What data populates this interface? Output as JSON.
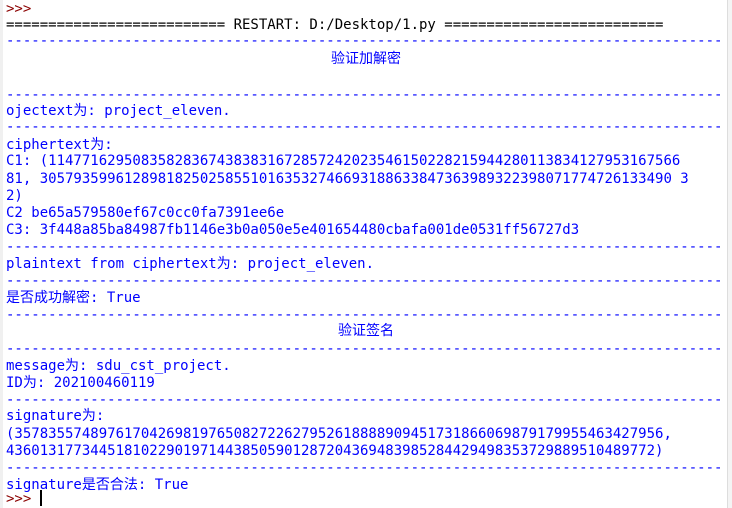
{
  "prompt_top": ">>>",
  "restart_line": "========================== RESTART: D:/Desktop/1.py ==========================",
  "sep": "-------------------------------------------------------------------------------------",
  "title_enc": "验证加解密",
  "plaintext_line": "ojectext为: project_eleven.",
  "cipher_label": "ciphertext为:",
  "c1_line1": "C1: (114771629508358283674383831672857242023546150228215944280113834127953167566",
  "c1_line2": "81, 305793599612898182502585510163532746693188633847363989322398071774726133490 3",
  "c1_line3": "2)",
  "c2_line": "C2 be65a579580ef67c0cc0fa7391ee6e",
  "c3_line": "C3: 3f448a85ba84987fb1146e3b0a050e5e401654480cbafa001de0531ff56727d3",
  "plaintext_from_cipher": "plaintext from ciphertext为: project_eleven.",
  "decrypt_ok": "是否成功解密: True",
  "title_sig": "验证签名",
  "message_line": "message为: sdu_cst_project.",
  "id_line": "ID为: 202100460119",
  "signature_label": "signature为:",
  "sig_line1": "(35783557489761704269819765082722627952618888909451731866069879179955463427956,",
  "sig_line2": "43601317734451810229019714438505901287204369483985284429498353729889510489772)",
  "sig_valid": "signature是否合法: True",
  "prompt_bottom": ">>>",
  "colors": {
    "output": "#0000ff",
    "prompt": "#8b0000",
    "restart": "#000000",
    "background": "#ffffff"
  }
}
